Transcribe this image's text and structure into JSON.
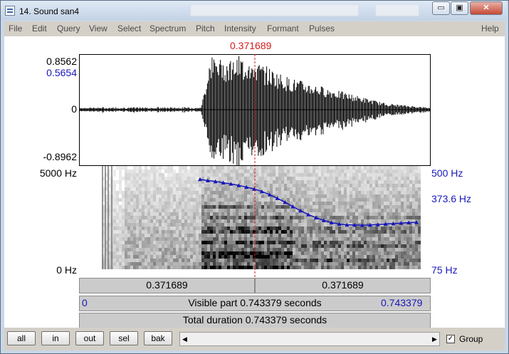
{
  "window": {
    "title": "14. Sound san4",
    "minimize_label": "▭",
    "maximize_label": "▣",
    "close_label": "✕"
  },
  "menu": {
    "items": [
      "File",
      "Edit",
      "Query",
      "View",
      "Select",
      "Spectrum",
      "Pitch",
      "Intensity",
      "Formant",
      "Pulses"
    ],
    "help": "Help"
  },
  "editor": {
    "cursor_time": "0.371689",
    "waveform": {
      "max_label": "0.8562",
      "cursor_value": "0.5654",
      "zero_label": "0",
      "min_label": "-0.8962"
    },
    "spectrogram": {
      "top_freq": "5000 Hz",
      "bottom_freq": "0 Hz",
      "pitch_top": "500 Hz",
      "pitch_cursor": "373.6 Hz",
      "pitch_bottom": "75 Hz"
    },
    "time_bar": {
      "left_segment": "0.371689",
      "right_segment": "0.371689"
    },
    "visible_bar": {
      "start": "0",
      "label": "Visible part 0.743379 seconds",
      "end": "0.743379"
    },
    "total_bar": {
      "label": "Total duration 0.743379 seconds"
    }
  },
  "bottom": {
    "buttons": [
      "all",
      "in",
      "out",
      "sel",
      "bak"
    ],
    "group_label": "Group",
    "group_checked": true,
    "scroll_left": "◀",
    "scroll_right": "▶"
  },
  "colors": {
    "cursor": "#d21a1a",
    "pitch": "#1717b8",
    "waveform": "#000000"
  },
  "pitch_contour_hz": [
    445,
    440,
    436,
    431,
    426,
    420,
    413,
    405,
    395,
    382,
    367,
    351,
    333,
    316,
    300,
    287,
    276,
    267,
    261,
    258,
    257,
    256,
    257,
    259,
    261,
    263,
    265,
    267,
    268
  ]
}
